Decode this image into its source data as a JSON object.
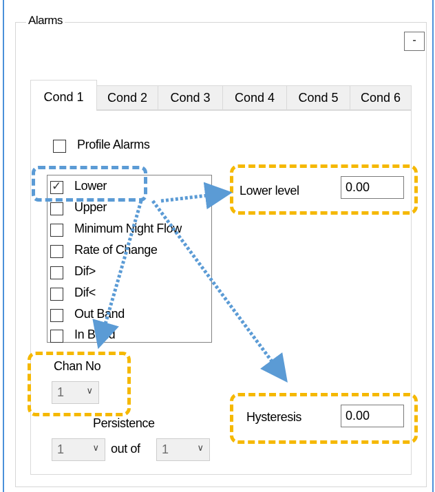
{
  "groupbox": {
    "title": "Alarms",
    "collapse_label": "-"
  },
  "tabs": [
    {
      "label": "Cond 1",
      "active": true
    },
    {
      "label": "Cond 2"
    },
    {
      "label": "Cond 3"
    },
    {
      "label": "Cond 4"
    },
    {
      "label": "Cond 5"
    },
    {
      "label": "Cond 6"
    }
  ],
  "profile_alarms": {
    "label": "Profile Alarms",
    "checked": false
  },
  "alarm_types": [
    {
      "label": "Lower",
      "checked": true
    },
    {
      "label": "Upper",
      "checked": false
    },
    {
      "label": "Minimum Night Flow",
      "checked": false
    },
    {
      "label": "Rate of Change",
      "checked": false
    },
    {
      "label": "Dif>",
      "checked": false
    },
    {
      "label": "Dif<",
      "checked": false
    },
    {
      "label": "Out Band",
      "checked": false
    },
    {
      "label": "In Band",
      "checked": false
    }
  ],
  "lower_level": {
    "label": "Lower level",
    "value": "0.00"
  },
  "chan_no": {
    "label": "Chan No",
    "value": "1"
  },
  "persistence": {
    "label": "Persistence",
    "value": "1",
    "out_of_label": "out of",
    "out_of_value": "1"
  },
  "hysteresis": {
    "label": "Hysteresis",
    "value": "0.00"
  },
  "colors": {
    "highlight_orange": "#f5b800",
    "highlight_blue": "#5b9bd5",
    "window_border": "#4a90d9"
  },
  "icons": {
    "dropdown": "chevron-down-icon",
    "check": "check-icon"
  }
}
